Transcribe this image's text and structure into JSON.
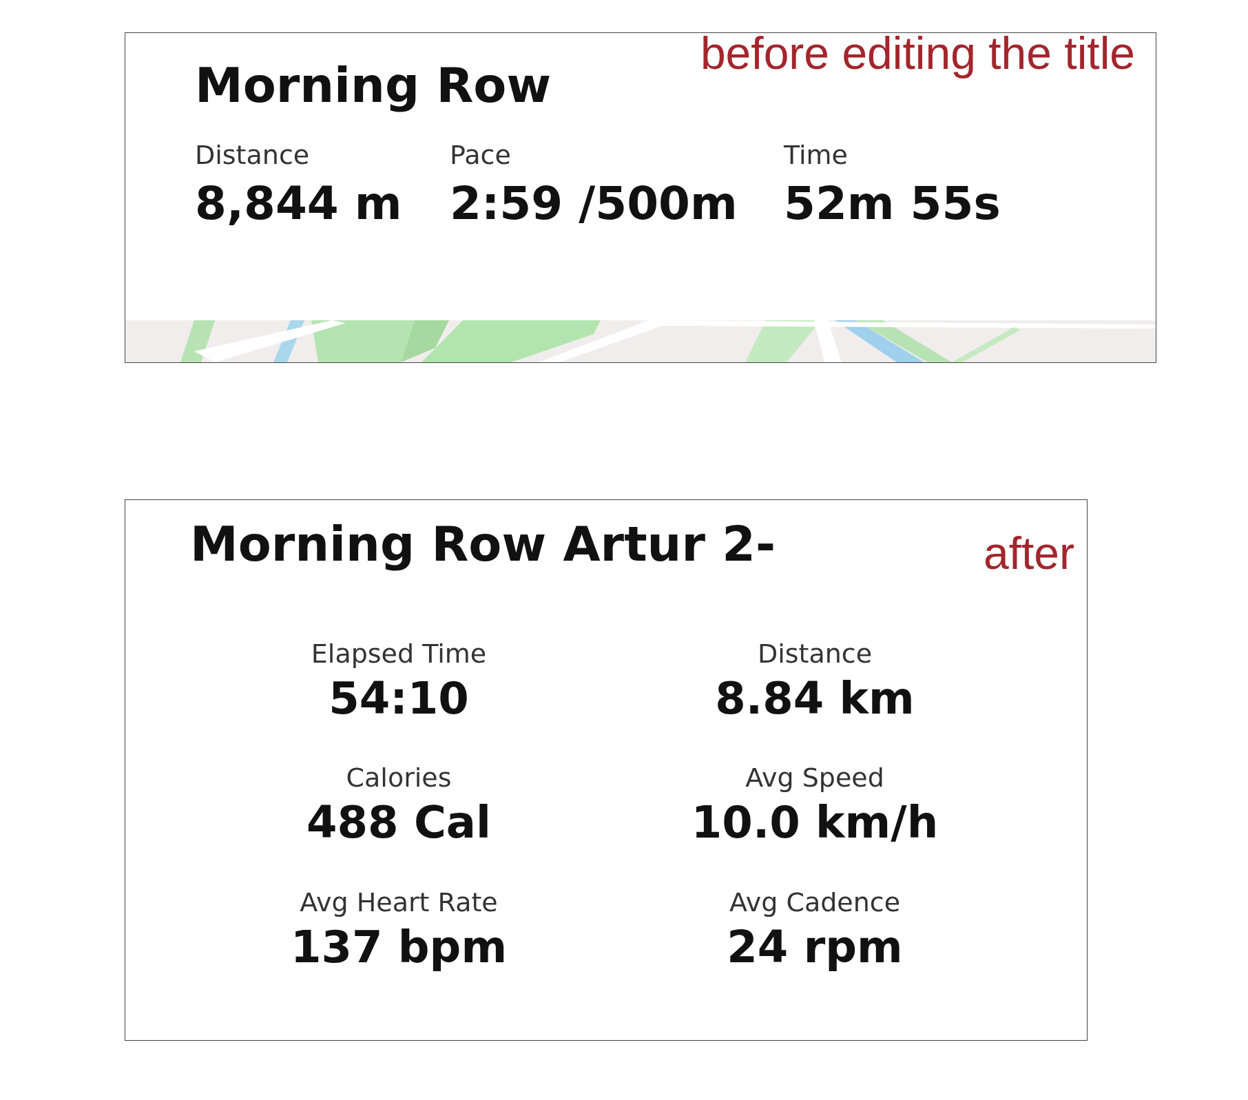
{
  "before": {
    "annotation": "before editing the title",
    "title": "Morning Row",
    "stats": [
      {
        "label": "Distance",
        "value": "8,844 m"
      },
      {
        "label": "Pace",
        "value": "2:59 /500m"
      },
      {
        "label": "Time",
        "value": "52m 55s"
      }
    ]
  },
  "after": {
    "annotation": "after",
    "title": "Morning Row Artur 2-",
    "stats": [
      {
        "label": "Elapsed Time",
        "value": "54:10"
      },
      {
        "label": "Distance",
        "value": "8.84 km"
      },
      {
        "label": "Calories",
        "value": "488 Cal"
      },
      {
        "label": "Avg Speed",
        "value": "10.0 km/h"
      },
      {
        "label": "Avg Heart Rate",
        "value": "137 bpm"
      },
      {
        "label": "Avg Cadence",
        "value": "24 rpm"
      }
    ]
  }
}
